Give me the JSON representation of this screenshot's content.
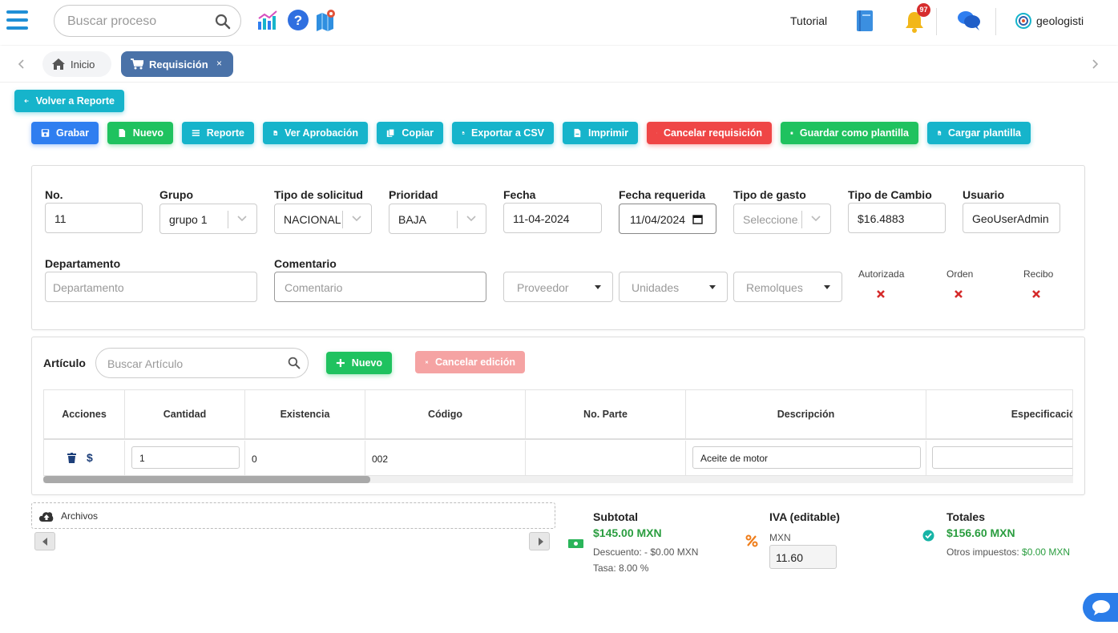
{
  "topbar": {
    "search_placeholder": "Buscar proceso",
    "tutorial_label": "Tutorial",
    "notification_count": "97",
    "user_name": "geologisti"
  },
  "tabs": {
    "home_label": "Inicio",
    "active_label": "Requisición",
    "close_glyph": "×"
  },
  "actions": {
    "back_label": "Volver a Reporte",
    "save_label": "Grabar",
    "new_label": "Nuevo",
    "report_label": "Reporte",
    "approval_label": "Ver Aprobación",
    "copy_label": "Copiar",
    "csv_label": "Exportar a CSV",
    "print_label": "Imprimir",
    "cancel_req_label": "Cancelar requisición",
    "save_template_label": "Guardar como plantilla",
    "load_template_label": "Cargar plantilla"
  },
  "form": {
    "no_label": "No.",
    "no_value": "11",
    "group_label": "Grupo",
    "group_value": "grupo 1",
    "request_type_label": "Tipo de solicitud",
    "request_type_value": "NACIONAL",
    "priority_label": "Prioridad",
    "priority_value": "BAJA",
    "date_label": "Fecha",
    "date_value": "11-04-2024",
    "required_date_label": "Fecha requerida",
    "required_date_value": "11/04/2024",
    "expense_type_label": "Tipo de gasto",
    "expense_type_placeholder": "Seleccione...",
    "exchange_label": "Tipo de Cambio",
    "exchange_value": "$16.4883",
    "user_label": "Usuario",
    "user_value": "GeoUserAdmin",
    "department_label": "Departamento",
    "department_placeholder": "Departamento",
    "comment_label": "Comentario",
    "comment_placeholder": "Comentario",
    "supplier_placeholder": "Proveedor",
    "units_placeholder": "Unidades",
    "trailers_placeholder": "Remolques",
    "authorized_label": "Autorizada",
    "order_label": "Orden",
    "receipt_label": "Recibo"
  },
  "articles": {
    "title": "Artículo",
    "search_placeholder": "Buscar Artículo",
    "new_label": "Nuevo",
    "cancel_edit_label": "Cancelar edición",
    "columns": [
      "Acciones",
      "Cantidad",
      "Existencia",
      "Código",
      "No. Parte",
      "Descripción",
      "Especificación"
    ],
    "rows": [
      {
        "quantity": "1",
        "stock": "0",
        "code": "002",
        "part_no": "",
        "description": "Aceite de motor",
        "spec": "",
        "price_glyph": "$"
      }
    ]
  },
  "files": {
    "label": "Archivos"
  },
  "totals": {
    "subtotal_label": "Subtotal",
    "subtotal_value": "$145.00 MXN",
    "discount_text": "Descuento: - $0.00 MXN",
    "rate_text": "Tasa: 8.00 %",
    "iva_label": "IVA (editable)",
    "iva_currency": "MXN",
    "iva_value": "11.60",
    "totals_label": "Totales",
    "totals_value": "$156.60 MXN",
    "other_taxes_label": "Otros impuestos:",
    "other_taxes_value": "$0.00 MXN"
  },
  "colors": {
    "primary_cyan": "#16b4cb",
    "save_blue": "#2f7ef0",
    "green": "#1fc25f",
    "red": "#ef4646",
    "tab_active": "#4a72a8",
    "money_green": "#2a9d3f"
  }
}
